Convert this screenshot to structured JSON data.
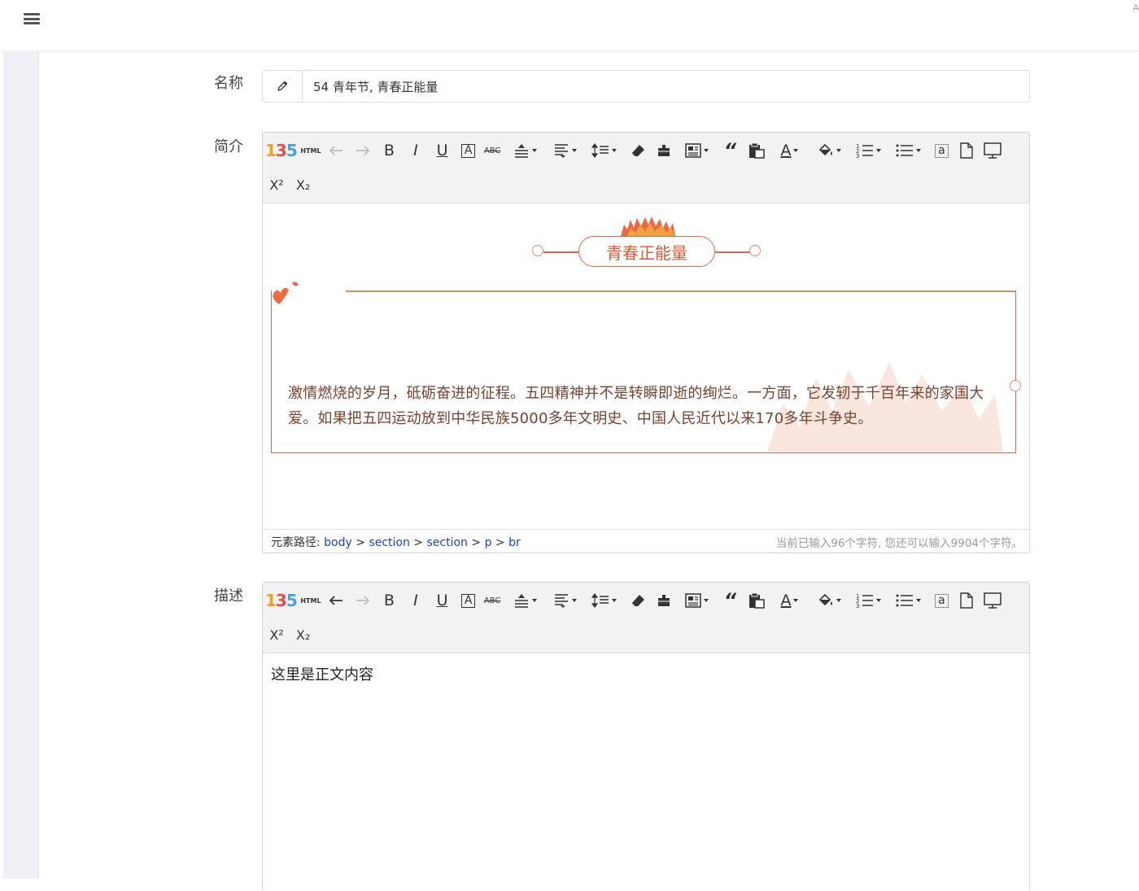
{
  "topbar": {
    "corner_text": "A"
  },
  "form": {
    "name_label": "名称",
    "name_value": "54 青年节, 青春正能量",
    "intro_label": "简介",
    "desc_label": "描述"
  },
  "toolbar_icons": [
    "logo-135-icon",
    "html-icon",
    "undo-icon",
    "redo-icon",
    "bold-icon",
    "italic-icon",
    "underline-icon",
    "font-border-icon",
    "strikethrough-icon",
    "paragraph-spacing-icon",
    "text-align-icon",
    "line-height-icon",
    "eraser-icon",
    "format-brush-icon",
    "template-icon",
    "blockquote-icon",
    "paste-plain-icon",
    "font-color-icon",
    "background-color-icon",
    "ordered-list-icon",
    "unordered-list-icon",
    "select-all-icon",
    "clear-doc-icon",
    "preview-icon",
    "superscript-icon",
    "subscript-icon"
  ],
  "toolbar_labels": {
    "html": "HTML",
    "bold": "B",
    "italic": "I",
    "underline": "U",
    "font_border": "A",
    "strikethrough": "ABC",
    "font_color": "A",
    "select_all": "a",
    "superscript": "X²",
    "subscript": "X₂"
  },
  "editor1": {
    "heading": "青春正能量",
    "paragraph": "激情燃烧的岁月，砥砺奋进的征程。五四精神并不是转瞬即逝的绚烂。一方面，它发轫于千百年来的家国大爱。如果把五四运动放到中华民族5000多年文明史、中国人民近代以来170多年斗争史。",
    "path_label": "元素路径: ",
    "path": [
      "body",
      "section",
      "section",
      "p",
      "br"
    ],
    "path_sep": " > ",
    "count_text": "当前已输入96个字符, 您还可以输入9904个字符。"
  },
  "editor2": {
    "body_text": "这里是正文内容"
  },
  "colors": {
    "accent": "#d76a4a",
    "link": "#1a3fcc",
    "toolbar_bg": "#f2f2f2",
    "gutter": "#eef0f5"
  }
}
